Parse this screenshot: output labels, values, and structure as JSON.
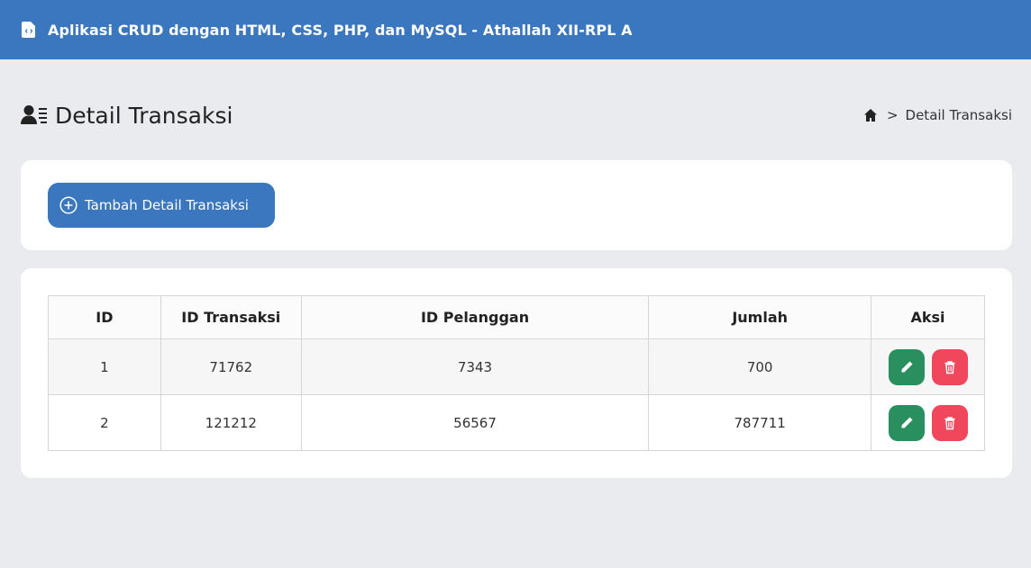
{
  "navbar": {
    "title": "Aplikasi CRUD dengan HTML, CSS, PHP, dan MySQL - Athallah XII-RPL A",
    "icon": "file-code-icon"
  },
  "header": {
    "title": "Detail Transaksi",
    "title_icon": "user-list-icon"
  },
  "breadcrumb": {
    "home_icon": "home-icon",
    "separator": ">",
    "current": "Detail Transaksi"
  },
  "toolbar": {
    "add_label": "Tambah Detail Transaksi",
    "add_icon": "plus-circle-icon"
  },
  "table": {
    "columns": [
      "ID",
      "ID Transaksi",
      "ID Pelanggan",
      "Jumlah",
      "Aksi"
    ],
    "rows": [
      {
        "id": "1",
        "id_transaksi": "71762",
        "id_pelanggan": "7343",
        "jumlah": "700"
      },
      {
        "id": "2",
        "id_transaksi": "121212",
        "id_pelanggan": "56567",
        "jumlah": "787711"
      }
    ]
  },
  "colors": {
    "primary": "#3a77bf",
    "edit": "#2a8f5e",
    "delete": "#f0475d",
    "background": "#e9ebef"
  }
}
